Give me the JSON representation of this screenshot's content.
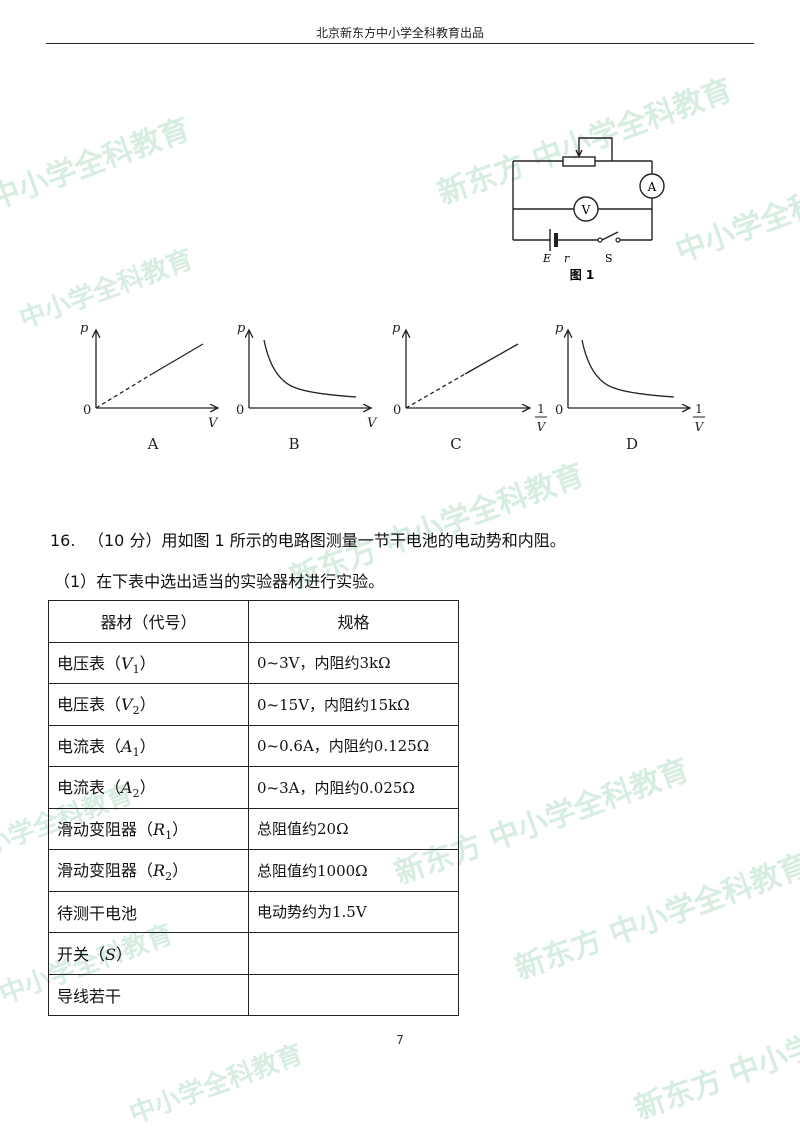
{
  "header": {
    "title": "北京新东方中小学全科教育出品"
  },
  "watermark": {
    "brand": "新东方",
    "text": "中小学全科教育"
  },
  "figure1": {
    "caption": "图 1",
    "ammeter": "A",
    "voltmeter": "V",
    "emf": "E",
    "internal_r": "r",
    "switch": "S"
  },
  "graphs": [
    {
      "label": "A",
      "y": "p",
      "x": "V",
      "origin": "0"
    },
    {
      "label": "B",
      "y": "p",
      "x": "V",
      "origin": "0"
    },
    {
      "label": "C",
      "y": "p",
      "x_num": "1",
      "x_den": "V",
      "origin": "0"
    },
    {
      "label": "D",
      "y": "p",
      "x_num": "1",
      "x_den": "V",
      "origin": "0"
    }
  ],
  "question": {
    "number": "16.",
    "stem": "（10 分）用如图 1 所示的电路图测量一节干电池的电动势和内阻。",
    "part1": "（1）在下表中选出适当的实验器材进行实验。"
  },
  "table": {
    "headers": [
      "器材（代号）",
      "规格"
    ],
    "rows": [
      {
        "name": "电压表（",
        "sym": "V",
        "sub": "1",
        "end": "）",
        "spec": "0~3V，内阻约3kΩ"
      },
      {
        "name": "电压表（",
        "sym": "V",
        "sub": "2",
        "end": "）",
        "spec": "0~15V，内阻约15kΩ"
      },
      {
        "name": "电流表（",
        "sym": "A",
        "sub": "1",
        "end": "）",
        "spec": "0~0.6A，内阻约0.125Ω"
      },
      {
        "name": "电流表（",
        "sym": "A",
        "sub": "2",
        "end": "）",
        "spec": "0~3A，内阻约0.025Ω"
      },
      {
        "name": "滑动变阻器（",
        "sym": "R",
        "sub": "1",
        "end": "）",
        "spec": "总阻值约20Ω"
      },
      {
        "name": "滑动变阻器（",
        "sym": "R",
        "sub": "2",
        "end": "）",
        "spec": "总阻值约1000Ω"
      },
      {
        "name": "待测干电池",
        "sym": "",
        "sub": "",
        "end": "",
        "spec": "电动势约为1.5V"
      },
      {
        "name": "开关（",
        "sym": "S",
        "sub": "",
        "end": "）",
        "spec": ""
      },
      {
        "name": "导线若干",
        "sym": "",
        "sub": "",
        "end": "",
        "spec": ""
      }
    ]
  },
  "page_number": "7"
}
